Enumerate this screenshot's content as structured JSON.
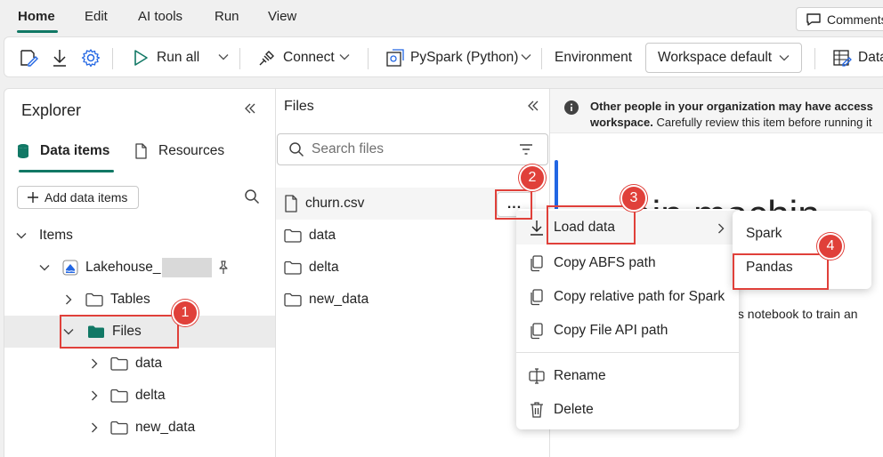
{
  "menu": {
    "items": [
      "Home",
      "Edit",
      "AI tools",
      "Run",
      "View"
    ],
    "comments_label": "Comments"
  },
  "toolbar": {
    "run_all": "Run all",
    "connect": "Connect",
    "kernel": "PySpark (Python)",
    "environment": "Environment",
    "workspace": "Workspace default",
    "data_wrangler": "Data"
  },
  "explorer": {
    "title": "Explorer",
    "tabs": [
      "Data items",
      "Resources"
    ],
    "add_button": "Add data items",
    "tree": {
      "items": "Items",
      "lakehouse": "Lakehouse_",
      "tables": "Tables",
      "files": "Files",
      "children": [
        "data",
        "delta",
        "new_data"
      ]
    }
  },
  "files": {
    "title": "Files",
    "search_placeholder": "Search files",
    "list": [
      "churn.csv",
      "data",
      "delta",
      "new_data"
    ],
    "more_label": "..."
  },
  "notebook": {
    "info_bold": "Other people in your organization may have access",
    "info_bold2": "workspace.",
    "info_rest": "Carefully review this item before running it",
    "heading1": "ain machin",
    "heading2": "a",
    "paragraph": "his notebook to train an"
  },
  "context_menu": {
    "items": [
      "Load data",
      "Copy ABFS path",
      "Copy relative path for Spark",
      "Copy File API path",
      "Rename",
      "Delete"
    ]
  },
  "submenu": {
    "items": [
      "Spark",
      "Pandas"
    ]
  },
  "annotations": {
    "badges": [
      "1",
      "2",
      "3",
      "4"
    ],
    "color": "#e0403a"
  },
  "colors": {
    "accent": "#117865",
    "info_blue": "#2266e3"
  }
}
